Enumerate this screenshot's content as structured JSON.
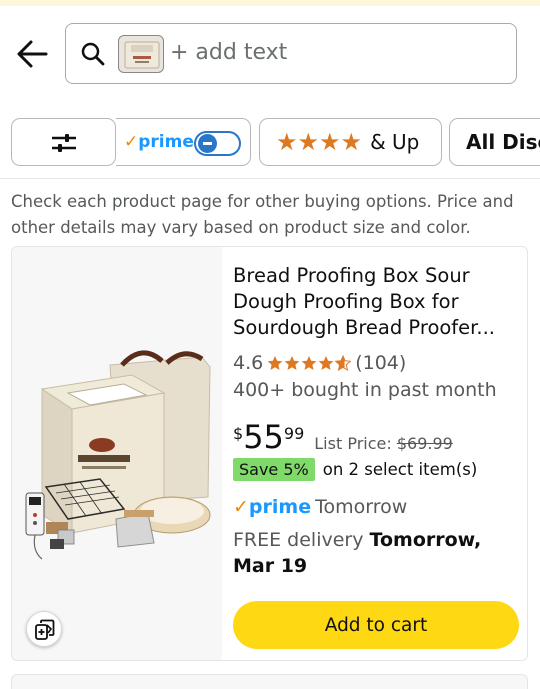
{
  "search": {
    "placeholder": "+ add text"
  },
  "filters": {
    "prime_label": "prime",
    "prime_check": "✓",
    "prime_enabled": false,
    "stars_label": "& Up",
    "stars_count": 4,
    "discount_label": "All Disco"
  },
  "notice": "Check each product page for other buying options. Price and other details may vary based on product size and color.",
  "product": {
    "title": "Bread Proofing Box Sour Dough Proofing Box for Sourdough Bread Proofer...",
    "rating": "4.6",
    "rating_value": 4.6,
    "review_count": "(104)",
    "bought": "400+ bought in past month",
    "price_symbol": "$",
    "price_whole": "55",
    "price_fraction": "99",
    "list_price_label": "List Price:",
    "list_price": "$69.99",
    "save_badge": "Save 5%",
    "save_text": "on 2 select item(s)",
    "prime_label": "prime",
    "prime_check": "✓",
    "prime_day": "Tomorrow",
    "delivery_prefix": "FREE delivery",
    "delivery_date": "Tomorrow, Mar 19",
    "add_to_cart": "Add to cart",
    "brand_on_box": "WOLTBLOOM"
  },
  "colors": {
    "accent_star": "#de7921",
    "prime_blue": "#1a98ff",
    "cart_yellow": "#ffd814",
    "save_green": "#7fda69"
  }
}
